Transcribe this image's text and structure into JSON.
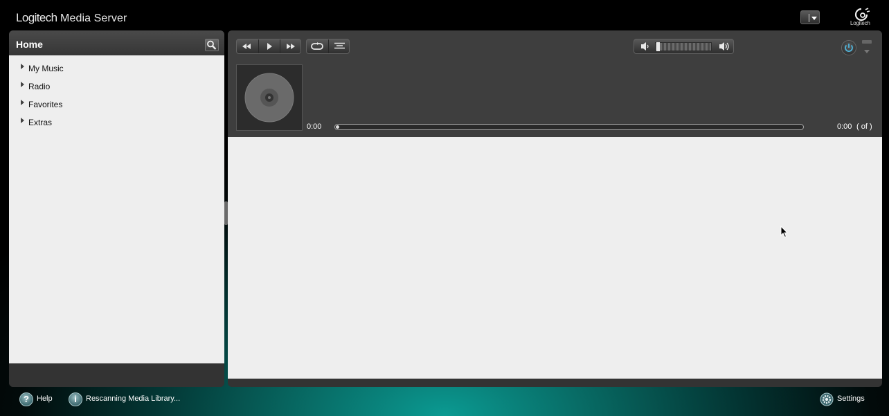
{
  "app": {
    "title_brand": "Logitech",
    "title_rest": "Media Server",
    "logo_text": "Logitech"
  },
  "left_panel": {
    "title": "Home",
    "items": [
      {
        "label": "My Music"
      },
      {
        "label": "Radio"
      },
      {
        "label": "Favorites"
      },
      {
        "label": "Extras"
      }
    ]
  },
  "player": {
    "elapsed": "0:00",
    "total": "0:00",
    "of_text": "( of )",
    "progress": 0,
    "volume": 0
  },
  "footer": {
    "help_label": "Help",
    "info_label": "Rescanning Media Library...",
    "settings_label": "Settings"
  },
  "colors": {
    "accent_teal": "#0b9a92",
    "panel_dark": "#333333",
    "content_bg": "#eeeeee"
  }
}
